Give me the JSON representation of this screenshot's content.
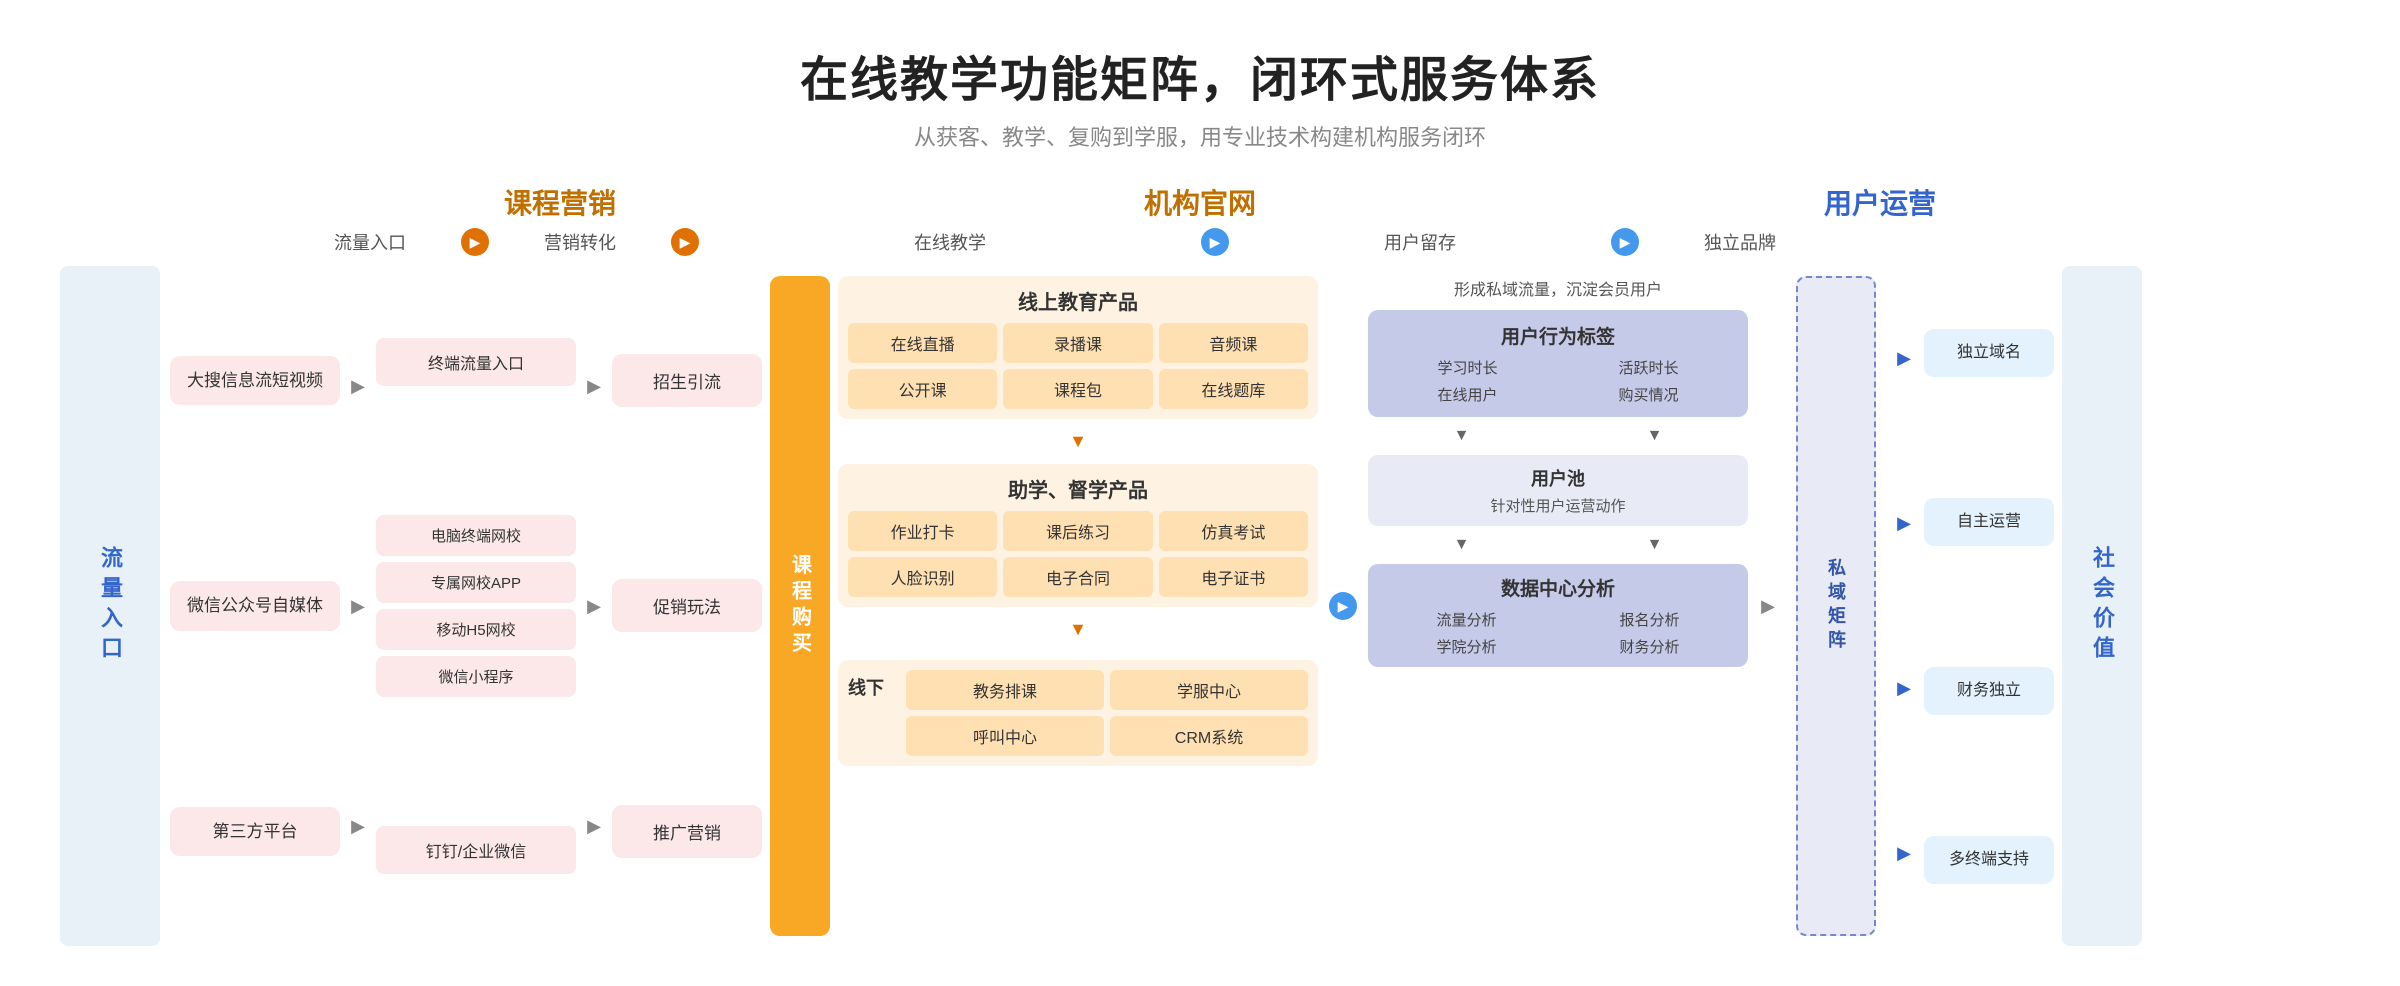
{
  "header": {
    "title": "在线教学功能矩阵，闭环式服务体系",
    "subtitle": "从获客、教学、复购到学服，用专业技术构建机构服务闭环"
  },
  "col_headers": {
    "marketing": "课程营销",
    "website": "机构官网",
    "ops": "用户运营"
  },
  "flow_steps": {
    "step1": "流量入口",
    "step2": "营销转化",
    "step3": "在线教学",
    "step4": "用户留存",
    "step5": "独立品牌"
  },
  "left_label": "流量入口",
  "right_label": "社会价值",
  "flow_items": [
    "大搜信息流短视频",
    "微信公众号自媒体",
    "第三方平台"
  ],
  "marketing_items": [
    "招生引流",
    "促销玩法",
    "推广营销"
  ],
  "marketing_mid_items": [
    "终端流量入口",
    "电脑终端网校",
    "专属网校APP",
    "移动H5网校",
    "微信小程序",
    "钉钉/企业微信"
  ],
  "purchase_label": "课程购买",
  "online_education": {
    "section_title": "线上教育产品",
    "items": [
      "在线直播",
      "录播课",
      "音频课",
      "公开课",
      "课程包",
      "在线题库"
    ]
  },
  "study_products": {
    "section_title": "助学、督学产品",
    "items": [
      "作业打卡",
      "课后练习",
      "仿真考试",
      "人脸识别",
      "电子合同",
      "电子证书"
    ]
  },
  "offline": {
    "label": "线下",
    "items": [
      "教务排课",
      "学服中心",
      "呼叫中心",
      "CRM系统"
    ]
  },
  "retention": {
    "top_text": "形成私域流量，沉淀会员用户",
    "behavior_title": "用户行为标签",
    "behavior_items": [
      "学习时长",
      "活跃时长",
      "在线用户",
      "购买情况"
    ],
    "user_pool_title": "用户池",
    "user_pool_sub": "针对性用户运营动作",
    "data_title": "数据中心分析",
    "data_items": [
      "流量分析",
      "报名分析",
      "学院分析",
      "财务分析"
    ]
  },
  "private_domain": "私域矩阵",
  "brand_items": [
    "独立域名",
    "自主运营",
    "财务独立",
    "多终端支持"
  ],
  "icons": {
    "arrow_right": "▶",
    "arrow_down": "▼",
    "circle_orange": "▶",
    "circle_blue": "▶"
  }
}
